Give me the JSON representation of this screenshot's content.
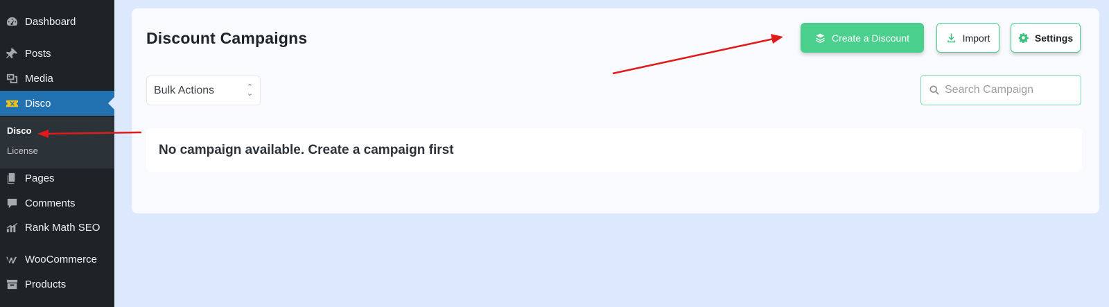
{
  "sidebar": {
    "items": [
      {
        "label": "Dashboard",
        "icon": "dashboard-icon"
      },
      {
        "label": "Posts",
        "icon": "pin-icon"
      },
      {
        "label": "Media",
        "icon": "media-icon"
      },
      {
        "label": "Disco",
        "icon": "ticket-icon",
        "active": true
      },
      {
        "label": "Pages",
        "icon": "pages-icon"
      },
      {
        "label": "Comments",
        "icon": "comment-icon"
      },
      {
        "label": "Rank Math SEO",
        "icon": "chart-icon"
      },
      {
        "label": "WooCommerce",
        "icon": "woo-icon"
      },
      {
        "label": "Products",
        "icon": "archive-icon"
      }
    ],
    "submenu": [
      {
        "label": "Disco",
        "current": true
      },
      {
        "label": "License"
      }
    ]
  },
  "main": {
    "title": "Discount Campaigns",
    "buttons": {
      "create": "Create a Discount",
      "import": "Import",
      "settings": "Settings"
    },
    "bulk_actions": "Bulk Actions",
    "search_placeholder": "Search Campaign",
    "empty_message": "No campaign available. Create a campaign first"
  },
  "colors": {
    "sidebar_bg": "#1d2327",
    "active_bg": "#2271b1",
    "accent_green": "#4bcf8d",
    "page_bg": "#dce9fd",
    "arrow_red": "#e01b1b"
  }
}
